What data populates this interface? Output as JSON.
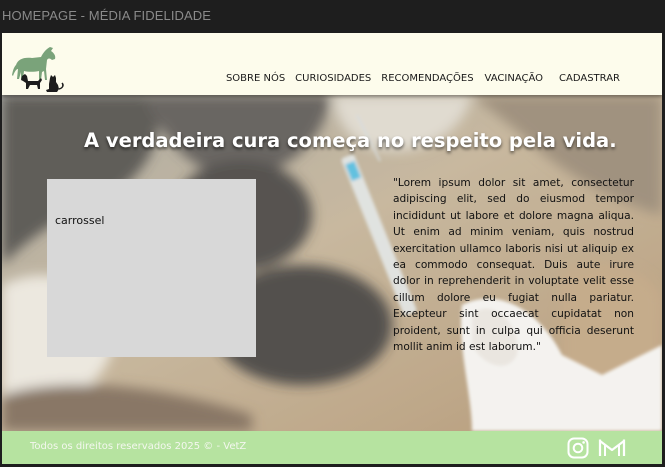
{
  "window": {
    "title": "HOMEPAGE - MÉDIA FIDELIDADE"
  },
  "header": {
    "logo_icon": "horse-dog-cat-silhouette-icon",
    "nav": [
      {
        "label": "SOBRE NÓS"
      },
      {
        "label": "CURIOSIDADES"
      },
      {
        "label": "RECOMENDAÇÕES"
      },
      {
        "label": "VACINAÇÃO"
      },
      {
        "label": "CADASTRAR"
      }
    ]
  },
  "hero": {
    "title": "A verdadeira cura começa no respeito pela vida.",
    "carousel_label": "carrossel",
    "paragraph": "\"Lorem ipsum dolor sit amet, consectetur adipiscing elit, sed do eiusmod tempor incididunt ut labore et dolore magna aliqua. Ut enim ad minim veniam, quis nostrud exercitation ullamco laboris nisi ut aliquip ex ea commodo consequat. Duis aute irure dolor in reprehenderit in voluptate velit esse cillum dolore eu fugiat nulla pariatur. Excepteur sint occaecat cupidatat non proident, sunt in culpa qui officia deserunt mollit anim id est laborum.\""
  },
  "footer": {
    "copyright": "Todos os direitos reservados 2025 © - VetZ",
    "icons": [
      "instagram-icon",
      "gmail-icon"
    ]
  },
  "colors": {
    "header_bg": "#fdfcec",
    "footer_bg": "#b6e3a0",
    "logo_green": "#7aa37a"
  }
}
